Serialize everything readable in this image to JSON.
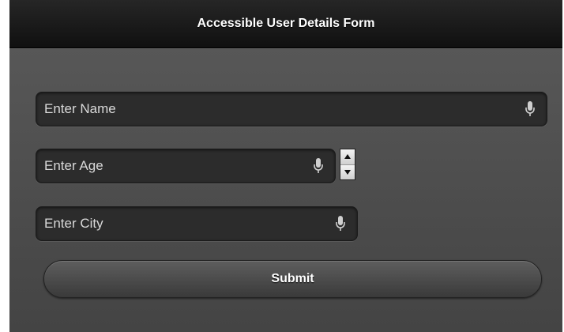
{
  "header": {
    "title": "Accessible User Details Form"
  },
  "form": {
    "name_field": {
      "placeholder": "Enter Name",
      "value": ""
    },
    "age_field": {
      "placeholder": "Enter Age",
      "value": ""
    },
    "city_field": {
      "placeholder": "Enter City",
      "value": ""
    },
    "submit_label": "Submit"
  },
  "icons": {
    "mic": "microphone-icon",
    "stepper_up": "arrow-up-icon",
    "stepper_down": "arrow-down-icon"
  },
  "colors": {
    "header_bg": "#1a1a1a",
    "page_bg": "#505050",
    "field_bg": "#2c2c2c",
    "text": "#ffffff"
  }
}
